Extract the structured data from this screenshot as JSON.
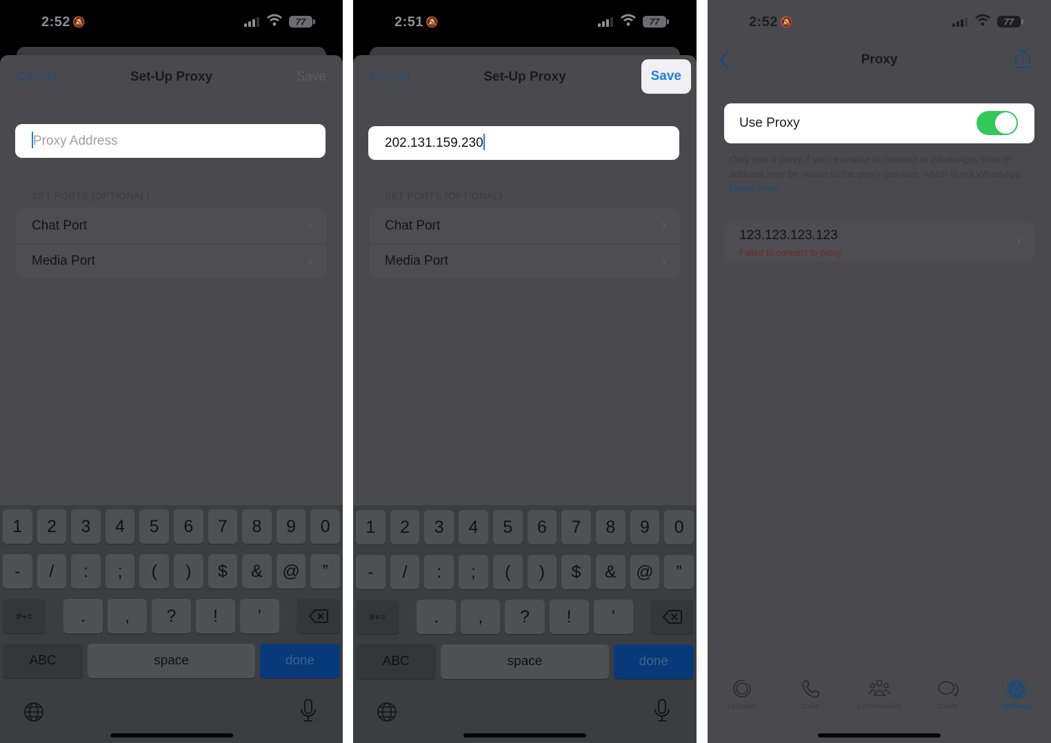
{
  "panels": [
    {
      "status": {
        "time": "2:52",
        "battery": "77"
      },
      "nav": {
        "cancel": "Cancel",
        "title": "Set-Up Proxy",
        "save": "Save",
        "save_enabled": false
      },
      "address": {
        "placeholder": "Proxy Address",
        "value": ""
      },
      "ports": {
        "header": "SET PORTS (OPTIONAL)",
        "items": [
          {
            "label": "Chat Port"
          },
          {
            "label": "Media Port"
          }
        ]
      }
    },
    {
      "status": {
        "time": "2:51",
        "battery": "77"
      },
      "nav": {
        "cancel": "Cancel",
        "title": "Set-Up Proxy",
        "save": "Save",
        "save_enabled": true
      },
      "address": {
        "placeholder": "Proxy Address",
        "value": "202.131.159.230"
      },
      "ports": {
        "header": "SET PORTS (OPTIONAL)",
        "items": [
          {
            "label": "Chat Port"
          },
          {
            "label": "Media Port"
          }
        ]
      }
    },
    {
      "status": {
        "time": "2:52",
        "battery": "77"
      },
      "nav": {
        "title": "Proxy",
        "back_icon": "chevron-left-icon",
        "share_icon": "share-icon"
      },
      "use_proxy": {
        "label": "Use Proxy",
        "enabled": true
      },
      "note": {
        "text": "Only use a proxy if you're unable to connect to WhatsApp. Your IP address may be visible to the proxy provider, which is not WhatsApp. ",
        "link": "Learn more"
      },
      "proxy": {
        "address": "123.123.123.123",
        "status": "Failed to connect to proxy"
      },
      "tabs": [
        {
          "label": "Updates",
          "icon": "updates-icon",
          "active": false
        },
        {
          "label": "Calls",
          "icon": "phone-icon",
          "active": false
        },
        {
          "label": "Communities",
          "icon": "communities-icon",
          "active": false
        },
        {
          "label": "Chats",
          "icon": "chats-icon",
          "active": false
        },
        {
          "label": "Settings",
          "icon": "settings-icon",
          "active": true
        }
      ]
    }
  ],
  "keyboard": {
    "row1": [
      "1",
      "2",
      "3",
      "4",
      "5",
      "6",
      "7",
      "8",
      "9",
      "0"
    ],
    "row2": [
      "-",
      "/",
      ":",
      ";",
      "(",
      ")",
      "$",
      "&",
      "@",
      "”"
    ],
    "row3": [
      "#+=",
      ".",
      ",",
      "?",
      "!",
      "’"
    ],
    "abc": "ABC",
    "space": "space",
    "done": "done"
  },
  "colors": {
    "accent": "#1a7ee6",
    "toggle_on": "#34c759",
    "error": "#6e2a24",
    "done_key": "#083a7a"
  }
}
